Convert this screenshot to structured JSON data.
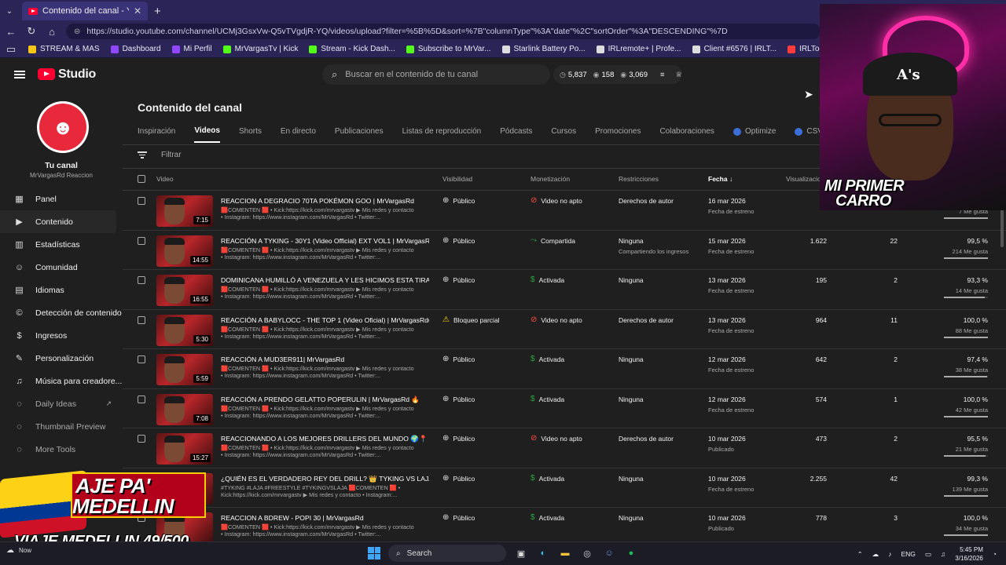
{
  "browser": {
    "tab_title": "Contenido del canal - YouTube St...",
    "url": "https://studio.youtube.com/channel/UCMj3GsxVw-Q5vTVgdjR-YQ/videos/upload?filter=%5B%5D&sort=%7B\"columnType\"%3A\"date\"%2C\"sortOrder\"%3A\"DESCENDING\"%7D",
    "bookmarks": [
      {
        "label": "STREAM & MAS",
        "color": "#f5c518"
      },
      {
        "label": "Dashboard",
        "color": "#9146ff"
      },
      {
        "label": "Mi Perfil",
        "color": "#9146ff"
      },
      {
        "label": "MrVargasTv | Kick",
        "color": "#53fc18"
      },
      {
        "label": "Stream - Kick Dash...",
        "color": "#53fc18"
      },
      {
        "label": "Subscribe to MrVar...",
        "color": "#53fc18"
      },
      {
        "label": "Starlink Battery Po...",
        "color": "#dddddd"
      },
      {
        "label": "IRLremote+ | Profe...",
        "color": "#dddddd"
      },
      {
        "label": "Client #6576 | IRLT...",
        "color": "#dddddd"
      },
      {
        "label": "IRLToolkit • Dashb...",
        "color": "#ff3b3b"
      },
      {
        "label": "Curva Wheels CFF76",
        "color": "#dddddd"
      }
    ]
  },
  "header": {
    "logo_text": "Studio",
    "search_placeholder": "Buscar en el contenido de tu canal",
    "stats": [
      "5,837",
      "158",
      "3,069"
    ]
  },
  "sidebar": {
    "channel_title": "Tu canal",
    "channel_name": "MrVargasRd Reaccion",
    "items": [
      {
        "label": "Panel",
        "icon": "▦"
      },
      {
        "label": "Contenido",
        "icon": "▶"
      },
      {
        "label": "Estadísticas",
        "icon": "▥"
      },
      {
        "label": "Comunidad",
        "icon": "☺"
      },
      {
        "label": "Idiomas",
        "icon": "▤"
      },
      {
        "label": "Detección de contenido",
        "icon": "©"
      },
      {
        "label": "Ingresos",
        "icon": "$"
      },
      {
        "label": "Personalización",
        "icon": "✎"
      },
      {
        "label": "Música para creadore...",
        "icon": "♫"
      },
      {
        "label": "Daily Ideas",
        "icon": "◌"
      },
      {
        "label": "Thumbnail Preview",
        "icon": "◌"
      },
      {
        "label": "More Tools",
        "icon": "◌"
      }
    ]
  },
  "main": {
    "page_title": "Contenido del canal",
    "tabs": [
      "Inspiración",
      "Videos",
      "Shorts",
      "En directo",
      "Publicaciones",
      "Listas de reproducción",
      "Pódcasts",
      "Cursos",
      "Promociones",
      "Colaboraciones",
      "Optimize",
      "CSV Export"
    ],
    "filter_placeholder": "Filtrar",
    "columns": {
      "video": "Video",
      "visibility": "Visibilidad",
      "monetization": "Monetización",
      "restrictions": "Restricciones",
      "date": "Fecha",
      "views": "Visualizacio"
    },
    "rows": [
      {
        "title": "REACCION A DEGRACIO 70TA POKÉMON GOO | MrVargasRd",
        "desc1": "🟥COMENTEN 🟥 • Kick:https://kick.com/mrvargastv ▶ Mis redes y contacto",
        "desc2": "• Instagram: https://www.instagram.com/MrVargasRd • Twitter:...",
        "duration": "7:15",
        "visibility": "Público",
        "vis_icon": "⊕",
        "monet": "Video no apto",
        "monet_kind": "red",
        "restr": "Derechos de autor",
        "restr_sub": "",
        "date": "16 mar 2026",
        "date_sub": "Fecha de estreno",
        "views": "",
        "comments": "",
        "pct": "",
        "likes": "7 Me gusta",
        "likes_ratio": 1.0
      },
      {
        "title": "REACCIÓN A TYKING - 30Y1 (Video Official) EXT VOL1 | MrVargasRd😱",
        "desc1": "🟥COMENTEN 🟥 • Kick:https://kick.com/mrvargastv ▶ Mis redes y contacto",
        "desc2": "• Instagram: https://www.instagram.com/MrVargasRd • Twitter:...",
        "duration": "14:55",
        "visibility": "Público",
        "vis_icon": "⊕",
        "monet": "Compartida",
        "monet_kind": "green",
        "restr": "Ninguna",
        "restr_sub": "Compartiendo los ingresos",
        "date": "15 mar 2026",
        "date_sub": "Fecha de estreno",
        "views": "1.622",
        "comments": "22",
        "pct": "99,5 %",
        "likes": "214 Me gusta",
        "likes_ratio": 0.995
      },
      {
        "title": "DOMINICANA HUMILLÓ A VENEZUELA Y LES HICIMOS ESTA TIRADERA: ...",
        "desc1": "🟥COMENTEN 🟥 • Kick:https://kick.com/mrvargastv ▶ Mis redes y contacto",
        "desc2": "• Instagram: https://www.instagram.com/MrVargasRd • Twitter:...",
        "duration": "16:55",
        "visibility": "Público",
        "vis_icon": "⊕",
        "monet": "Activada",
        "monet_kind": "green",
        "restr": "Ninguna",
        "restr_sub": "",
        "date": "13 mar 2026",
        "date_sub": "Fecha de estreno",
        "views": "195",
        "comments": "2",
        "pct": "93,3 %",
        "likes": "14 Me gusta",
        "likes_ratio": 0.933
      },
      {
        "title": "REACCIÓN A BABYLOCC - THE TOP 1 (Video Oficial) | MrVargasRd😱",
        "desc1": "🟥COMENTEN 🟥 • Kick:https://kick.com/mrvargastv ▶ Mis redes y contacto",
        "desc2": "• Instagram: https://www.instagram.com/MrVargasRd • Twitter:...",
        "duration": "5:30",
        "visibility": "Bloqueo parcial",
        "vis_icon": "⚠",
        "monet": "Video no apto",
        "monet_kind": "red",
        "restr": "Derechos de autor",
        "restr_sub": "",
        "date": "13 mar 2026",
        "date_sub": "Fecha de estreno",
        "views": "964",
        "comments": "11",
        "pct": "100,0 %",
        "likes": "88 Me gusta",
        "likes_ratio": 1.0
      },
      {
        "title": "REACCIÓN A MUD3ER911| MrVargasRd",
        "desc1": "🟥COMENTEN 🟥 • Kick:https://kick.com/mrvargastv ▶ Mis redes y contacto",
        "desc2": "• Instagram: https://www.instagram.com/MrVargasRd • Twitter:...",
        "duration": "5:59",
        "visibility": "Público",
        "vis_icon": "⊕",
        "monet": "Activada",
        "monet_kind": "green",
        "restr": "Ninguna",
        "restr_sub": "",
        "date": "12 mar 2026",
        "date_sub": "Fecha de estreno",
        "views": "642",
        "comments": "2",
        "pct": "97,4 %",
        "likes": "38 Me gusta",
        "likes_ratio": 0.974
      },
      {
        "title": "REACCIÓN A PRENDO GELATTO POPERULIN | MrVargasRd 🔥",
        "desc1": "🟥COMENTEN 🟥 • Kick:https://kick.com/mrvargastv ▶ Mis redes y contacto",
        "desc2": "• Instagram: https://www.instagram.com/MrVargasRd • Twitter:...",
        "duration": "7:08",
        "visibility": "Público",
        "vis_icon": "⊕",
        "monet": "Activada",
        "monet_kind": "green",
        "restr": "Ninguna",
        "restr_sub": "",
        "date": "12 mar 2026",
        "date_sub": "Fecha de estreno",
        "views": "574",
        "comments": "1",
        "pct": "100,0 %",
        "likes": "42 Me gusta",
        "likes_ratio": 1.0
      },
      {
        "title": "REACCIONANDO A LOS MEJORES DRILLERS DEL MUNDO 🌍📍 | MrVar...",
        "desc1": "🟥COMENTEN 🟥 • Kick:https://kick.com/mrvargastv ▶ Mis redes y contacto",
        "desc2": "• Instagram: https://www.instagram.com/MrVargasRd • Twitter:...",
        "duration": "15:27",
        "visibility": "Público",
        "vis_icon": "⊕",
        "monet": "Video no apto",
        "monet_kind": "red",
        "restr": "Derechos de autor",
        "restr_sub": "",
        "date": "10 mar 2026",
        "date_sub": "Publicado",
        "views": "473",
        "comments": "2",
        "pct": "95,5 %",
        "likes": "21 Me gusta",
        "likes_ratio": 0.955
      },
      {
        "title": "¿QUIÉN ES EL VERDADERO REY DEL DRILL? 👑 TYKING VS LAJA | LA VE...",
        "desc1": "#TYKING #LAJA #FREESTYLE #TYKINGVSLAJA 🟥COMENTEN 🟥 •",
        "desc2": "Kick:https://kick.com/mrvargastv ▶ Mis redes y contacto • Instagram:...",
        "duration": "",
        "visibility": "Público",
        "vis_icon": "⊕",
        "monet": "Activada",
        "monet_kind": "green",
        "restr": "Ninguna",
        "restr_sub": "",
        "date": "10 mar 2026",
        "date_sub": "Fecha de estreno",
        "views": "2.255",
        "comments": "42",
        "pct": "99,3 %",
        "likes": "139 Me gusta",
        "likes_ratio": 0.993
      },
      {
        "title": "REACCION A BDREW - POPI 30 | MrVargasRd",
        "desc1": "🟥COMENTEN 🟥 • Kick:https://kick.com/mrvargastv ▶ Mis redes y contacto",
        "desc2": "• Instagram: https://www.instagram.com/MrVargasRd • Twitter:...",
        "duration": "",
        "visibility": "Público",
        "vis_icon": "⊕",
        "monet": "Activada",
        "monet_kind": "green",
        "restr": "Ninguna",
        "restr_sub": "",
        "date": "10 mar 2026",
        "date_sub": "Publicado",
        "views": "778",
        "comments": "3",
        "pct": "100,0 %",
        "likes": "34 Me gusta",
        "likes_ratio": 1.0
      }
    ]
  },
  "overlay": {
    "cam_text_1": "MI PRIMER",
    "cam_text_2": "CARRO",
    "promo_line_1": "AJE PA'",
    "promo_line_2": "MEDELLIN",
    "promo_sub": "VIAJE MEDELLIN 49/500"
  },
  "taskbar": {
    "left_label": "Now",
    "search_label": "Search",
    "language": "ENG",
    "time": "5:45 PM",
    "date": "3/16/2026"
  }
}
